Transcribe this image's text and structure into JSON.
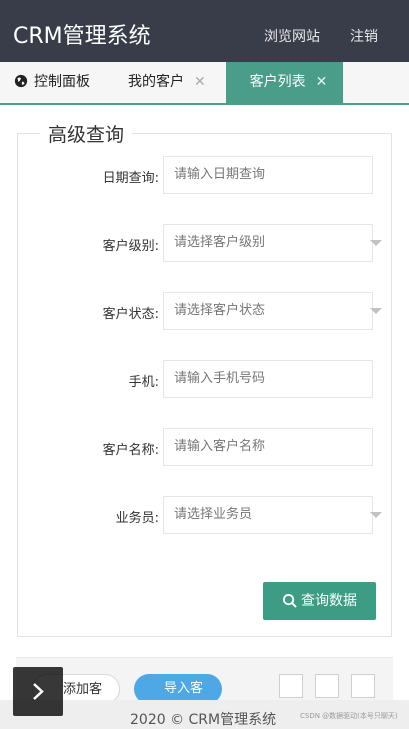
{
  "app": {
    "logo": "CRM管理系统",
    "nav_browse": "浏览网站",
    "nav_logout": "注销"
  },
  "tabs": [
    {
      "label": "控制面板",
      "icon": "globe-icon",
      "closable": false,
      "active": false
    },
    {
      "label": "我的客户",
      "closable": true,
      "active": false
    },
    {
      "label": "客户列表",
      "closable": true,
      "active": true
    }
  ],
  "search": {
    "legend": "高级查询",
    "fields": [
      {
        "label": "日期查询:",
        "placeholder": "请输入日期查询",
        "type": "input"
      },
      {
        "label": "客户级别:",
        "placeholder": "请选择客户级别",
        "type": "select"
      },
      {
        "label": "客户状态:",
        "placeholder": "请选择客户状态",
        "type": "select"
      },
      {
        "label": "手机:",
        "placeholder": "请输入手机号码",
        "type": "input"
      },
      {
        "label": "客户名称:",
        "placeholder": "请输入客户名称",
        "type": "input"
      },
      {
        "label": "业务员:",
        "placeholder": "请选择业务员",
        "type": "select"
      }
    ],
    "submit_label": "查询数据"
  },
  "toolbar": {
    "add_label": "添加客户",
    "import_label": "导入客户",
    "icons": [
      "grid-icon",
      "print-icon",
      "export-icon"
    ]
  },
  "footer": {
    "copyright": "2020 ©    CRM管理系统",
    "watermark": "CSDN @数据驱动(本号只聊天)"
  },
  "colors": {
    "header_bg": "#393d49",
    "accent": "#3d9c84",
    "import_blue": "#4fa8e6"
  }
}
